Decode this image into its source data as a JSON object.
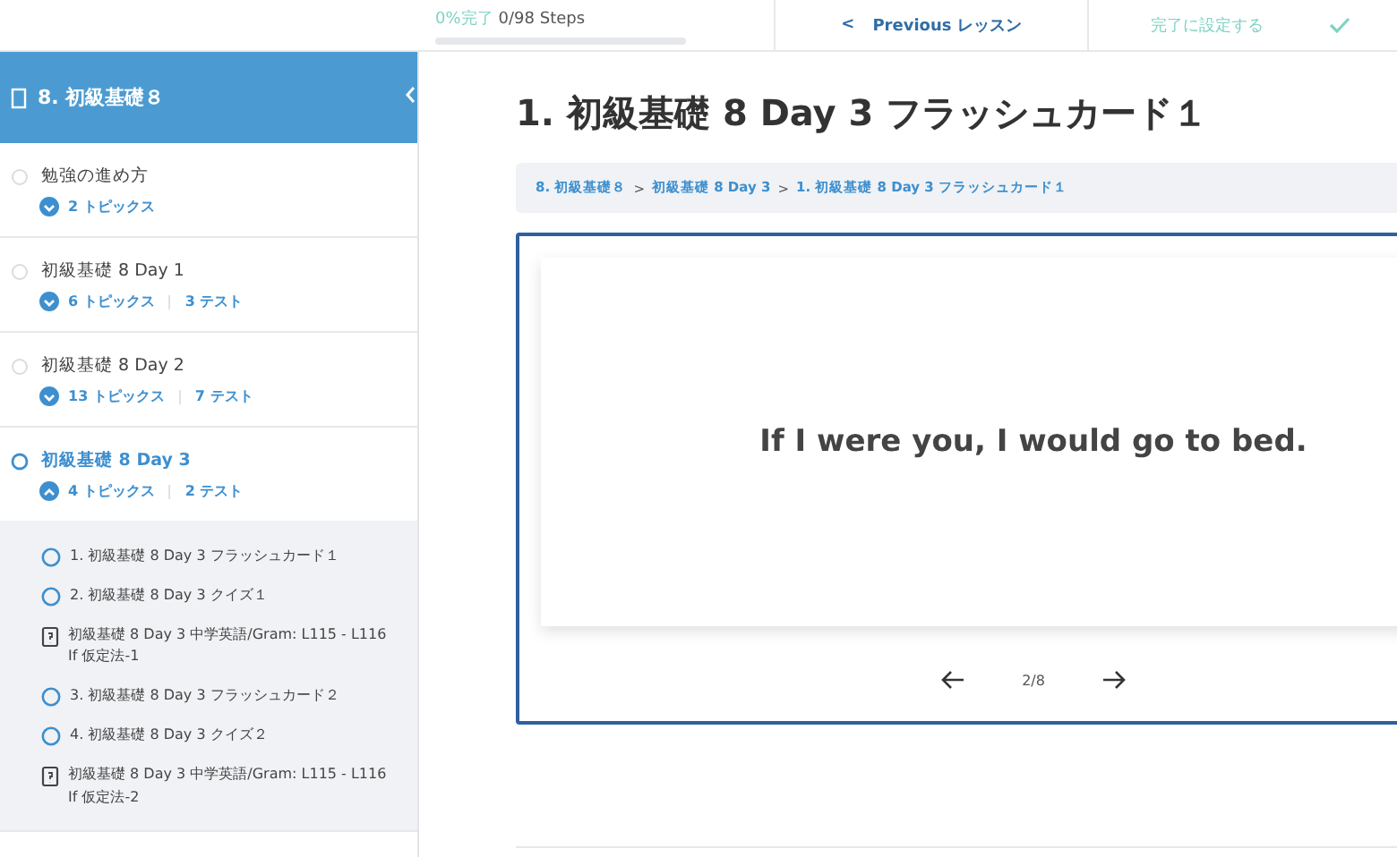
{
  "progress": {
    "label": "0%完了",
    "steps": "0/98 Steps",
    "level": 0
  },
  "previous_button": {
    "icon": "<",
    "label": "Previous レッスン"
  },
  "complete_button": {
    "label": "完了に設定する"
  },
  "sidebar": {
    "title": "8. 初級基礎８",
    "lessons": [
      {
        "title": "勉強の進め方",
        "current": false,
        "expanded": false,
        "topics_count": "2 トピックス"
      },
      {
        "title": "初級基礎 8 Day 1",
        "current": false,
        "expanded": false,
        "topics_count": "6 トピックス",
        "tests_count": "3 テスト"
      },
      {
        "title": "初級基礎 8 Day 2",
        "current": false,
        "expanded": false,
        "topics_count": "13 トピックス",
        "tests_count": "7 テスト"
      },
      {
        "title": "初級基礎 8 Day 3",
        "current": true,
        "expanded": true,
        "topics_count": "4 トピックス",
        "tests_count": "2 テスト",
        "children": [
          {
            "kind": "topic",
            "title": "1. 初級基礎 8 Day 3 フラッシュカード１"
          },
          {
            "kind": "topic",
            "title": "2. 初級基礎 8 Day 3 クイズ１"
          },
          {
            "kind": "quiz",
            "title": "初級基礎 8 Day 3 中学英語/Gram: L115 - L116 If 仮定法-1"
          },
          {
            "kind": "topic",
            "title": "3. 初級基礎 8 Day 3 フラッシュカード２"
          },
          {
            "kind": "topic",
            "title": "4. 初級基礎 8 Day 3 クイズ２"
          },
          {
            "kind": "quiz",
            "title": "初級基礎 8 Day 3 中学英語/Gram: L115 - L116 If 仮定法-2"
          }
        ]
      }
    ]
  },
  "page_title": "1. 初級基礎 8 Day 3 フラッシュカード１",
  "breadcrumb_separator": ">",
  "breadcrumbs": [
    "8. 初級基礎８",
    "初級基礎 8 Day 3",
    "1. 初級基礎 8 Day 3 フラッシュカード１"
  ],
  "flashcard": {
    "text": "If I were you, I would go to bed.",
    "counter": "2/8"
  }
}
